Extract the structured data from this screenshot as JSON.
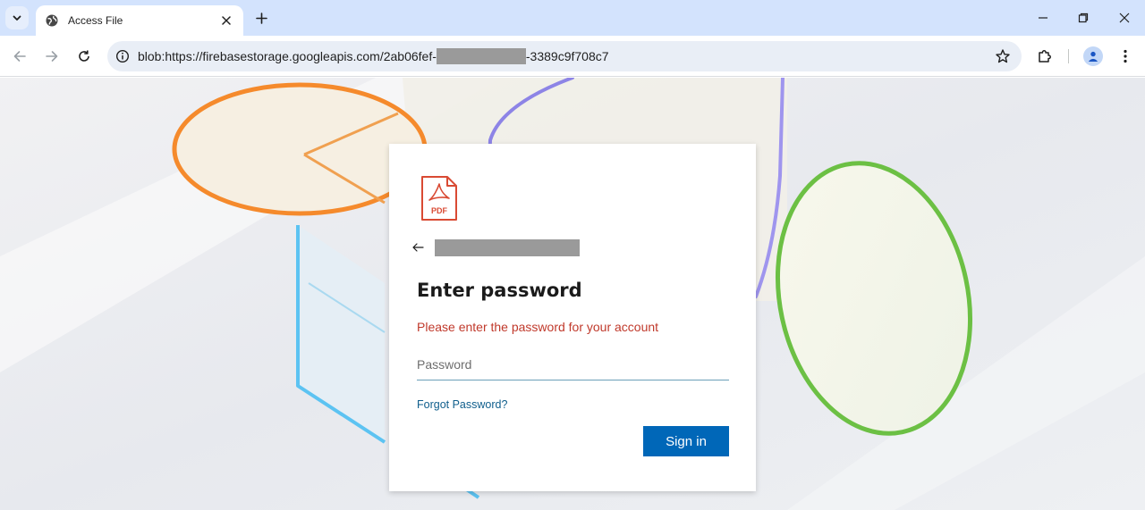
{
  "browser": {
    "tab": {
      "title": "Access File"
    },
    "omnibox": {
      "url_prefix": "blob:https://firebasestorage.googleapis.com/2ab06fef-",
      "url_suffix": "-3389c9f708c7"
    }
  },
  "login": {
    "file_badge": "PDF",
    "title": "Enter password",
    "error": "Please enter the password for your account",
    "password_placeholder": "Password",
    "forgot_link": "Forgot Password?",
    "signin_label": "Sign in"
  },
  "colors": {
    "tabstrip": "#d3e3fd",
    "signin_button": "#0067b8",
    "error_text": "#c0392b",
    "link_text": "#0f5e8c"
  },
  "icons": {
    "tab_search": "chevron-down-icon",
    "favicon": "globe-icon",
    "tab_close": "close-icon",
    "new_tab": "plus-icon",
    "back": "arrow-left-icon",
    "forward": "arrow-right-icon",
    "reload": "reload-icon",
    "site_info": "info-icon",
    "bookmark": "star-icon",
    "extensions": "puzzle-icon",
    "profile": "person-icon",
    "menu": "kebab-menu-icon"
  }
}
